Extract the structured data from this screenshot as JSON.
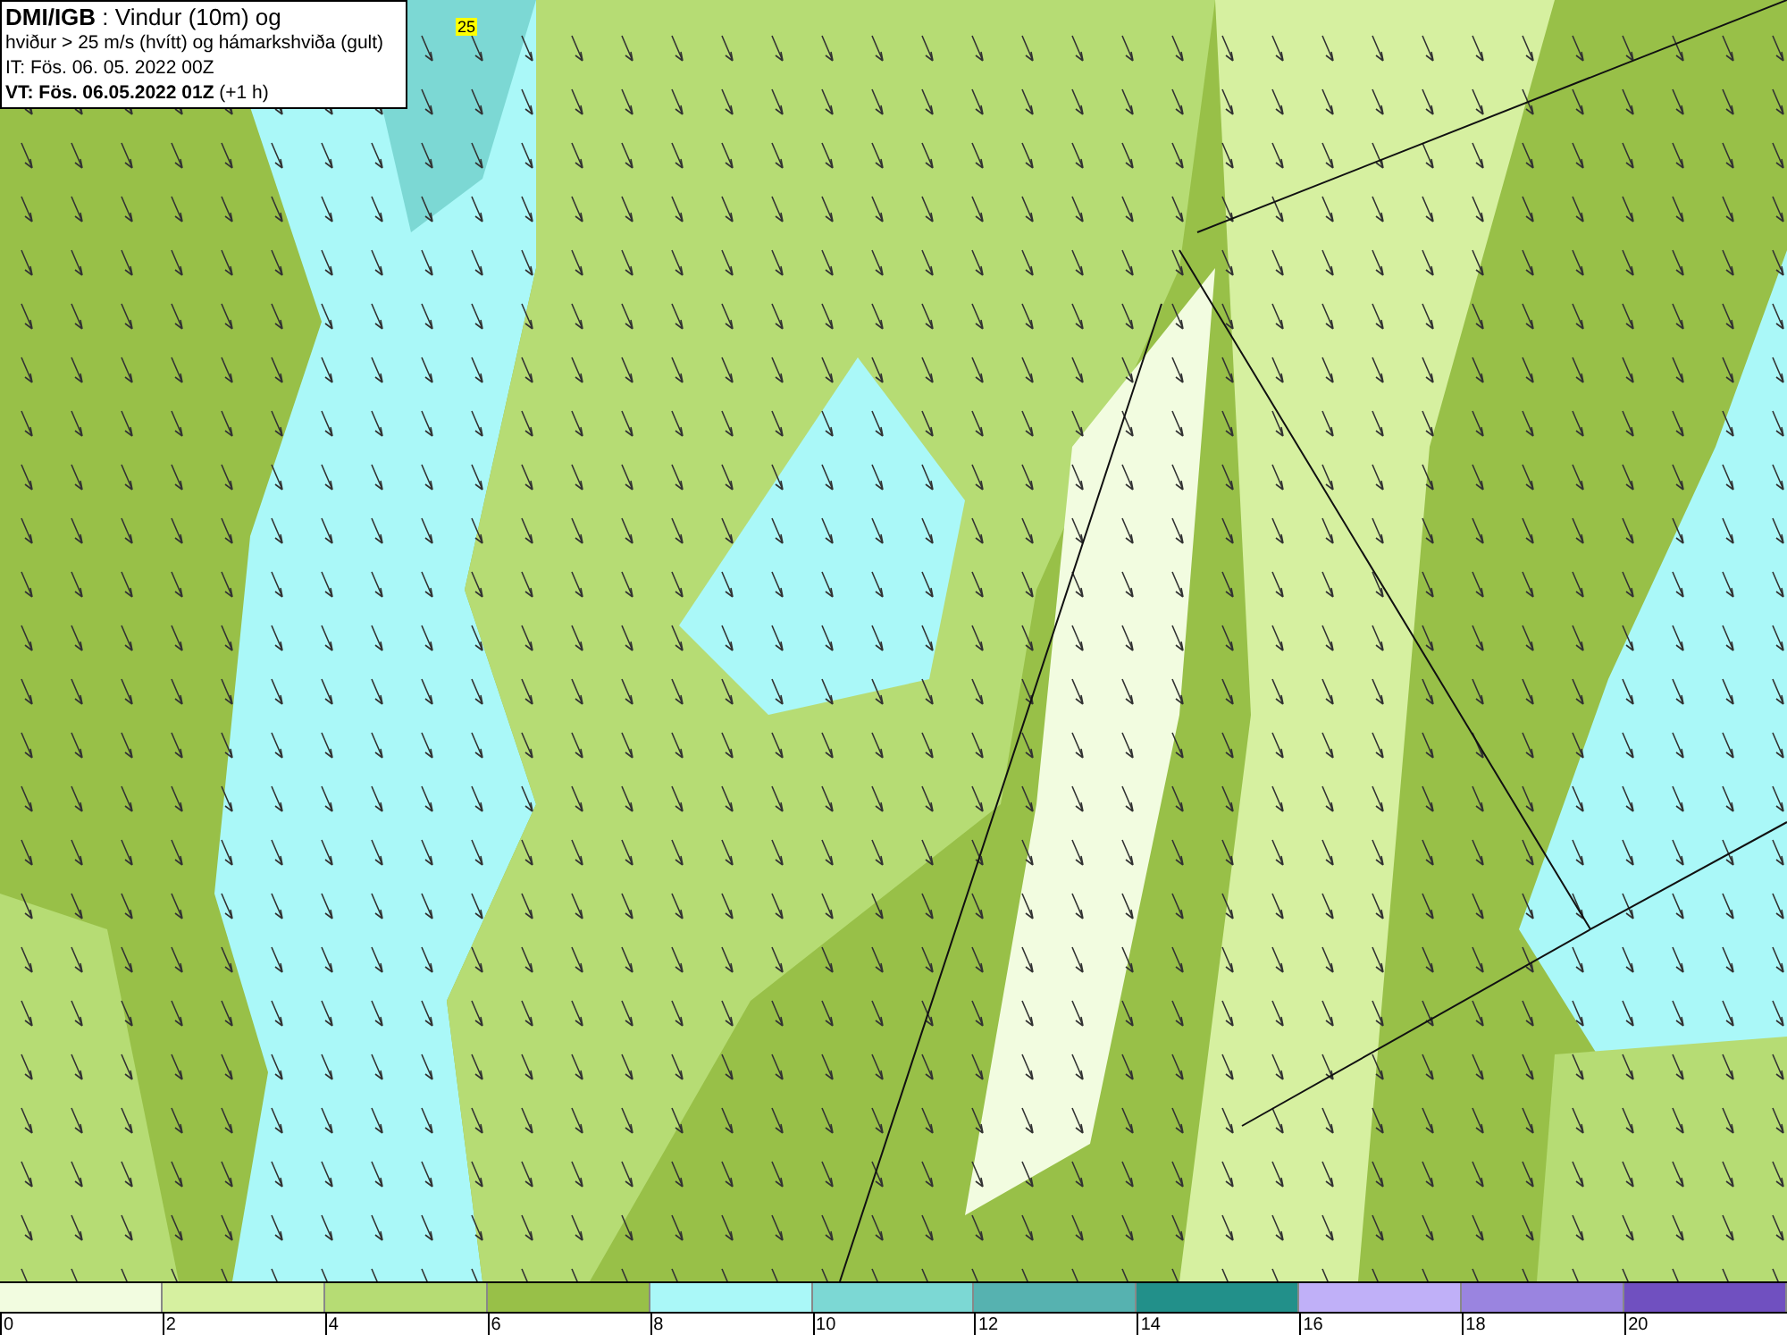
{
  "header": {
    "lines": [
      "**DMI/IGB** : Vindur (10m) og",
      "hviður > 25 m/s (hvítt) og hámarkshviða (gult)",
      "IT: Fös. 06. 05. 2022 00Z",
      "**VT: Fös. 06.05.2022 01Z** (+1 h)"
    ]
  },
  "map": {
    "gust_labels": [
      "25"
    ]
  },
  "legend": {
    "segments": [
      {
        "color": "#f2fce0"
      },
      {
        "color": "#d6f0a0"
      },
      {
        "color": "#b6dc74"
      },
      {
        "color": "#98c048"
      },
      {
        "color": "#aaf8f8"
      },
      {
        "color": "#7cd8d4"
      },
      {
        "color": "#56b2b0"
      },
      {
        "color": "#22908a"
      },
      {
        "color": "#c0b0f8"
      },
      {
        "color": "#9a84e0"
      },
      {
        "color": "#7050c0"
      }
    ],
    "ticks": [
      "0",
      "2",
      "4",
      "6",
      "8",
      "10",
      "12",
      "14",
      "16",
      "18",
      "20"
    ]
  }
}
